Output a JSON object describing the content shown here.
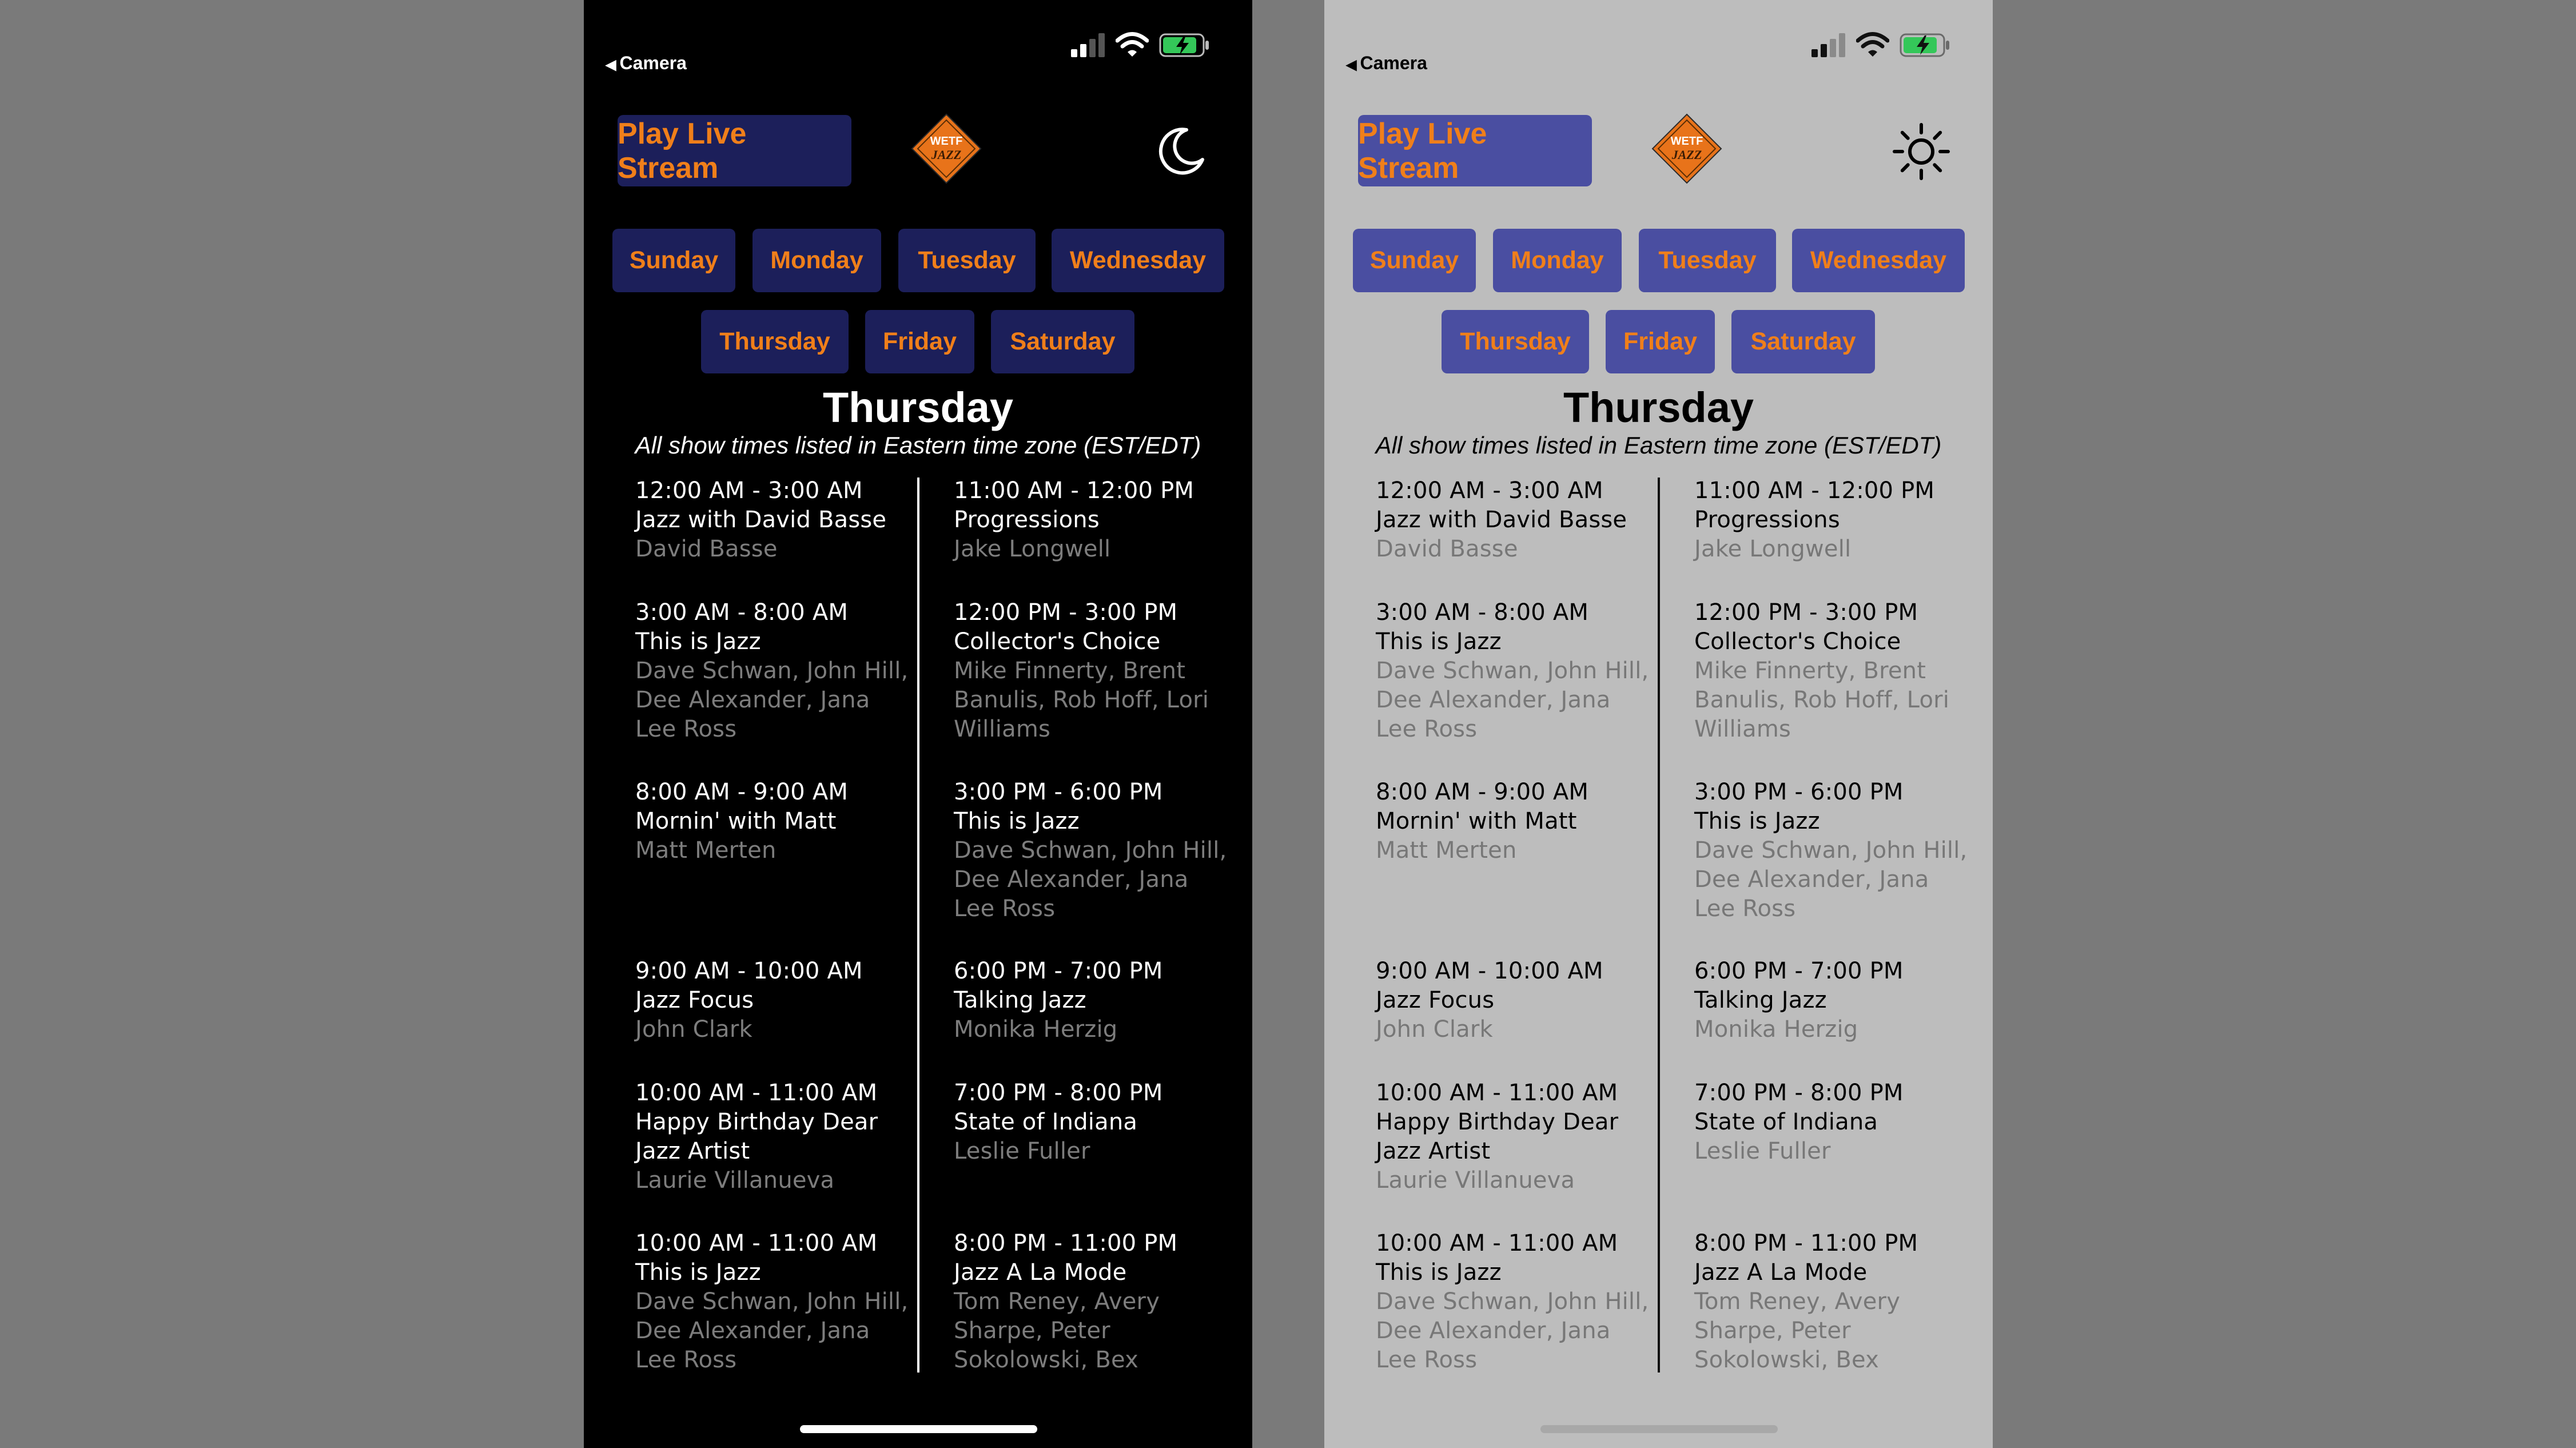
{
  "status_bar": {
    "back_label": "Camera"
  },
  "header": {
    "play_button_label": "Play Live Stream",
    "logo_text": "WETF",
    "logo_subtext": "JAZZ"
  },
  "mode_icons": {
    "dark": "moon-icon",
    "light": "sun-icon"
  },
  "days": [
    "Sunday",
    "Monday",
    "Tuesday",
    "Wednesday",
    "Thursday",
    "Friday",
    "Saturday"
  ],
  "selected_day": "Thursday",
  "timezone_note": "All show times listed in Eastern time zone (EST/EDT)",
  "schedule": {
    "left": [
      {
        "time": "12:00 AM - 3:00 AM",
        "name": "Jazz with David Basse",
        "hosts": "David Basse"
      },
      {
        "time": "3:00 AM - 8:00 AM",
        "name": "This is Jazz",
        "hosts": "Dave Schwan, John Hill, Dee Alexander, Jana Lee Ross"
      },
      {
        "time": "8:00 AM - 9:00 AM",
        "name": "Mornin' with Matt",
        "hosts": "Matt Merten"
      },
      {
        "time": "9:00 AM - 10:00 AM",
        "name": "Jazz Focus",
        "hosts": "John Clark"
      },
      {
        "time": "10:00 AM - 11:00 AM",
        "name": "Happy Birthday Dear Jazz Artist",
        "hosts": "Laurie Villanueva"
      },
      {
        "time": "10:00 AM - 11:00 AM",
        "name": "This is Jazz",
        "hosts": "Dave Schwan, John Hill, Dee Alexander, Jana Lee Ross"
      }
    ],
    "right": [
      {
        "time": "11:00 AM - 12:00 PM",
        "name": "Progressions",
        "hosts": "Jake Longwell"
      },
      {
        "time": "12:00 PM - 3:00 PM",
        "name": "Collector's Choice",
        "hosts": "Mike Finnerty, Brent Banulis, Rob Hoff, Lori Williams"
      },
      {
        "time": "3:00 PM - 6:00 PM",
        "name": "This is Jazz",
        "hosts": "Dave Schwan, John Hill, Dee Alexander, Jana Lee Ross"
      },
      {
        "time": "6:00 PM - 7:00 PM",
        "name": "Talking Jazz",
        "hosts": "Monika Herzig"
      },
      {
        "time": "7:00 PM - 8:00 PM",
        "name": "State of Indiana",
        "hosts": "Leslie Fuller"
      },
      {
        "time": "8:00 PM - 11:00 PM",
        "name": "Jazz A La Mode",
        "hosts": "Tom Reney, Avery Sharpe, Peter Sokolowski, Bex"
      }
    ]
  },
  "colors": {
    "accent": "#f07f1a",
    "button_dark": "#1c1f5a",
    "button_light": "#4a4ea1",
    "bg_dark": "#000000",
    "bg_light": "#bdbdbd",
    "host_text": "#7d7d7d",
    "page_bg": "#7a7a7a"
  }
}
